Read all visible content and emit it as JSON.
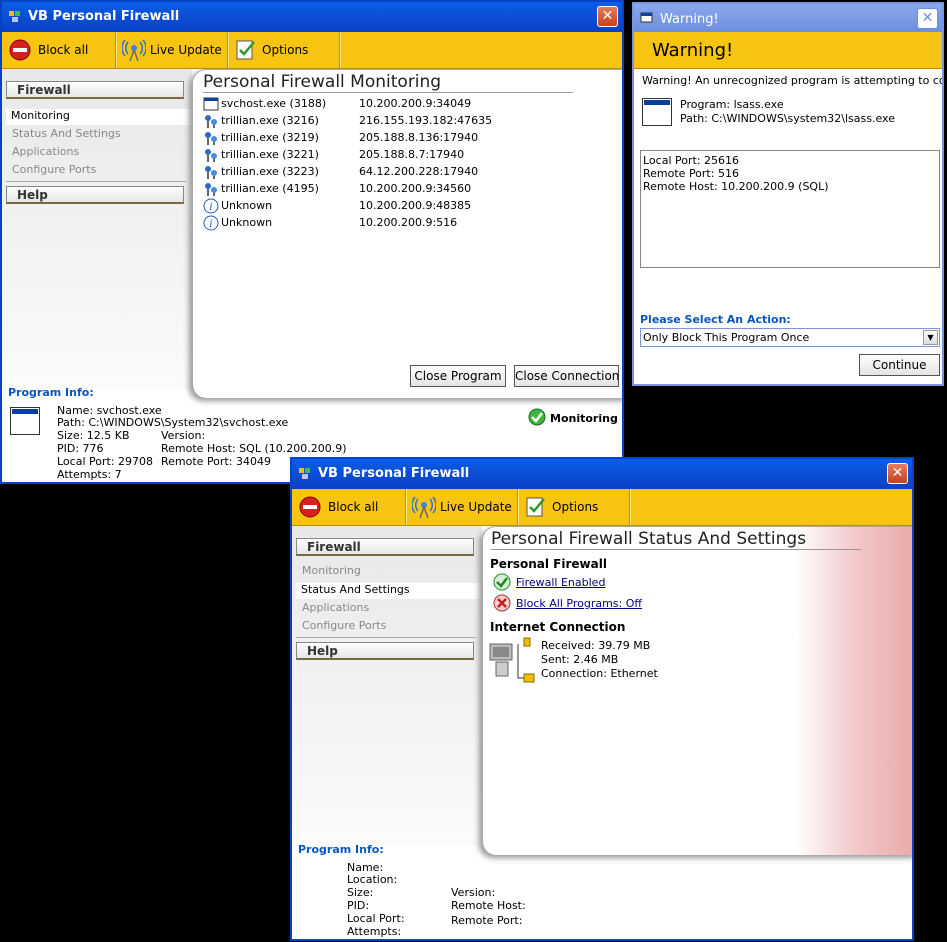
{
  "win1": {
    "title": "VB Personal Firewall",
    "close": "✕",
    "toolbar": {
      "block_all": "Block all",
      "live_update": "Live Update",
      "options": "Options"
    },
    "sidebar": {
      "firewall": "Firewall",
      "items": [
        "Monitoring",
        "Status And Settings",
        "Applications",
        "Configure Ports"
      ],
      "help": "Help"
    },
    "panel_title": "Personal Firewall Monitoring",
    "connections": [
      {
        "name": "svchost.exe (3188)",
        "addr": "10.200.200.9:34049",
        "icon": "window-icon"
      },
      {
        "name": "trillian.exe (3216)",
        "addr": "216.155.193.182:47635",
        "icon": "trillian-icon"
      },
      {
        "name": "trillian.exe (3219)",
        "addr": "205.188.8.136:17940",
        "icon": "trillian-icon"
      },
      {
        "name": "trillian.exe (3221)",
        "addr": "205.188.8.7:17940",
        "icon": "trillian-icon"
      },
      {
        "name": "trillian.exe (3223)",
        "addr": "64.12.200.228:17940",
        "icon": "trillian-icon"
      },
      {
        "name": "trillian.exe (4195)",
        "addr": "10.200.200.9:34560",
        "icon": "trillian-icon"
      },
      {
        "name": "Unknown",
        "addr": "10.200.200.9:48385",
        "icon": "info-icon"
      },
      {
        "name": "Unknown",
        "addr": "10.200.200.9:516",
        "icon": "info-icon"
      }
    ],
    "close_program": "Close Program",
    "close_connection": "Close Connection",
    "program_info": {
      "title": "Program Info:",
      "name": "Name: svchost.exe",
      "path": "Path: C:\\WINDOWS\\System32\\svchost.exe",
      "size": "Size: 12.5 KB",
      "version": "Version:",
      "pid": "PID: 776",
      "remote_host": "Remote Host: SQL (10.200.200.9)",
      "local_port": "Local Port: 29708",
      "remote_port": "Remote Port: 34049",
      "attempts": "Attempts: 7"
    },
    "monitoring": "Monitoring"
  },
  "warning": {
    "title": "Warning!",
    "heading": "Warning!",
    "close": "✕",
    "message": "Warning! An unrecognized program is attempting to connect.",
    "program": "Program: lsass.exe",
    "path": "Path: C:\\WINDOWS\\system32\\lsass.exe",
    "details": [
      "Local Port: 25616",
      "Remote Port: 516",
      "Remote Host: 10.200.200.9 (SQL)"
    ],
    "action_label": "Please Select An Action:",
    "action_value": "Only Block This Program Once",
    "continue": "Continue"
  },
  "win2": {
    "title": "VB Personal Firewall",
    "close": "✕",
    "toolbar": {
      "block_all": "Block all",
      "live_update": "Live Update",
      "options": "Options"
    },
    "sidebar": {
      "firewall": "Firewall",
      "items": [
        "Monitoring",
        "Status And Settings",
        "Applications",
        "Configure Ports"
      ],
      "help": "Help"
    },
    "panel_title": "Personal Firewall Status And Settings",
    "section_firewall": "Personal Firewall",
    "firewall_enabled": "Firewall Enabled",
    "block_all_programs": "Block All Programs: Off",
    "section_internet": "Internet Connection",
    "received": "Received: 39.79 MB",
    "sent": "Sent: 2.46 MB",
    "connection": "Connection: Ethernet",
    "program_info": {
      "title": "Program Info:",
      "name": "Name:",
      "location": "Location:",
      "size": "Size:",
      "version": "Version:",
      "pid": "PID:",
      "remote_host": "Remote Host:",
      "local_port": "Local Port:",
      "remote_port": "Remote Port:",
      "attempts": "Attempts:"
    }
  },
  "colors": {
    "titlebar": "#0b4fd6",
    "toolbar": "#f8c412",
    "accent_text": "#0a55c4",
    "link": "#000080"
  }
}
